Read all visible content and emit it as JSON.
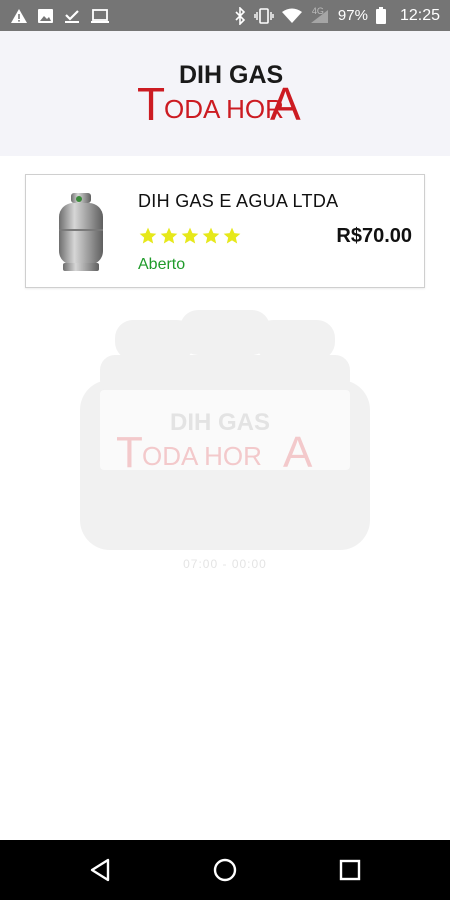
{
  "status_bar": {
    "left_icons": [
      "warning-icon",
      "image-icon",
      "download-done-icon",
      "laptop-icon"
    ],
    "right_icons": [
      "bluetooth-icon",
      "vibrate-icon",
      "wifi-icon",
      "signal-icon",
      "battery-icon"
    ],
    "network": "4G",
    "battery": "97%",
    "time": "12:25"
  },
  "header": {
    "logo_top": "DIH GAS",
    "logo_bottom_t": "T",
    "logo_bottom_mid": "ODA HOR",
    "logo_bottom_a": "A",
    "colors": {
      "red": "#cc1b22",
      "dark": "#1a1a1a"
    }
  },
  "store": {
    "name": "DIH GAS E AGUA LTDA",
    "rating": 5,
    "price": "R$70.00",
    "status": "Aberto",
    "star_color": "#e6e81a",
    "status_color": "#1f9b2a",
    "image_icon": "gas-cylinder-icon"
  },
  "watermark": {
    "logo_top": "DIH GAS",
    "logo_bottom_t": "T",
    "logo_bottom_mid": "ODA HOR",
    "logo_bottom_a": "A",
    "hours": "07:00 - 00:00"
  },
  "nav_bar": {
    "buttons": [
      "back-icon",
      "home-icon",
      "recents-icon"
    ]
  }
}
